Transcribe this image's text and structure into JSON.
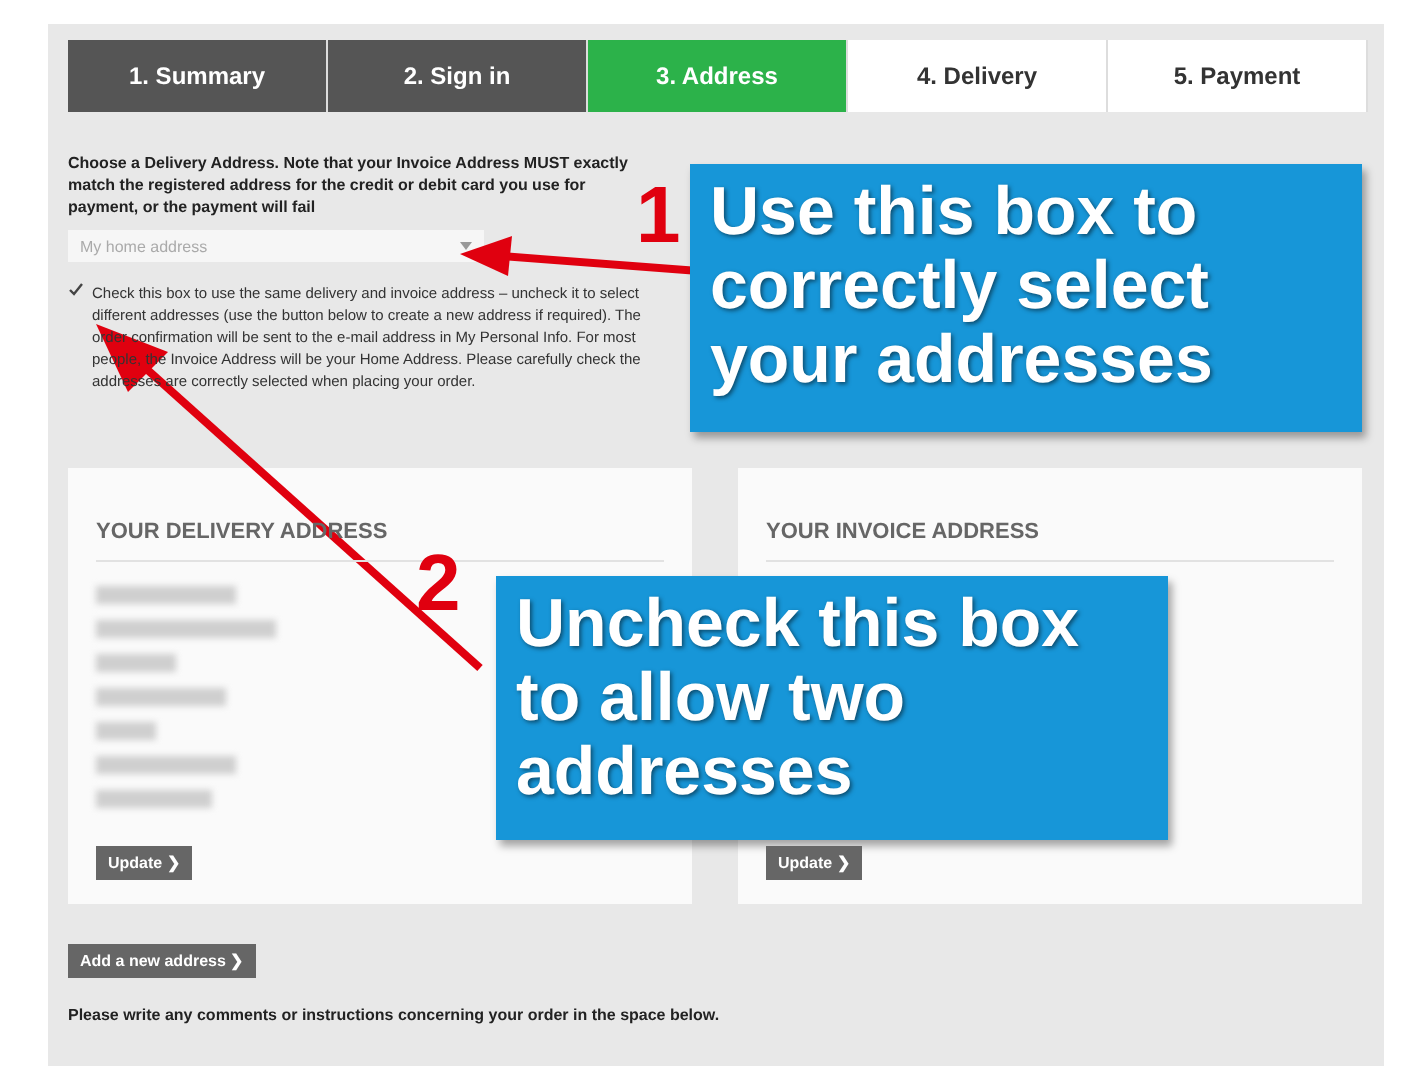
{
  "steps": [
    {
      "label": "1. Summary",
      "selected": false,
      "completed": true
    },
    {
      "label": "2. Sign in",
      "selected": false,
      "completed": true
    },
    {
      "label": "3. Address",
      "selected": true,
      "completed": false
    },
    {
      "label": "4. Delivery",
      "selected": false,
      "completed": false
    },
    {
      "label": "5. Payment",
      "selected": false,
      "completed": false
    }
  ],
  "intro": "Choose a Delivery Address. Note that your Invoice Address MUST exactly match the registered address for the credit or debit card you use for payment, or the payment will fail",
  "address_select": {
    "value": "My home address"
  },
  "same_address": {
    "checked": true,
    "label": "Check this box to use the same delivery and invoice address – uncheck it to select different addresses (use the button below to create a new address if required). The order confirmation will be sent to the e-mail address in My Personal Info. For most people, the Invoice Address will be your Home Address. Please carefully check the addresses are correctly selected when placing your order."
  },
  "cards": [
    {
      "title": "YOUR DELIVERY ADDRESS",
      "button": "Update ❯",
      "blurred": true
    },
    {
      "title": "YOUR INVOICE ADDRESS",
      "button": "Update ❯"
    }
  ],
  "add_button": "Add a new address ❯",
  "comments_label": "Please write any comments or instructions concerning your order in the space below.",
  "callouts": [
    {
      "number": "1",
      "text": "Use this box to correctly select your addresses"
    },
    {
      "number": "2",
      "text": "Uncheck this box to allow two addresses"
    }
  ]
}
